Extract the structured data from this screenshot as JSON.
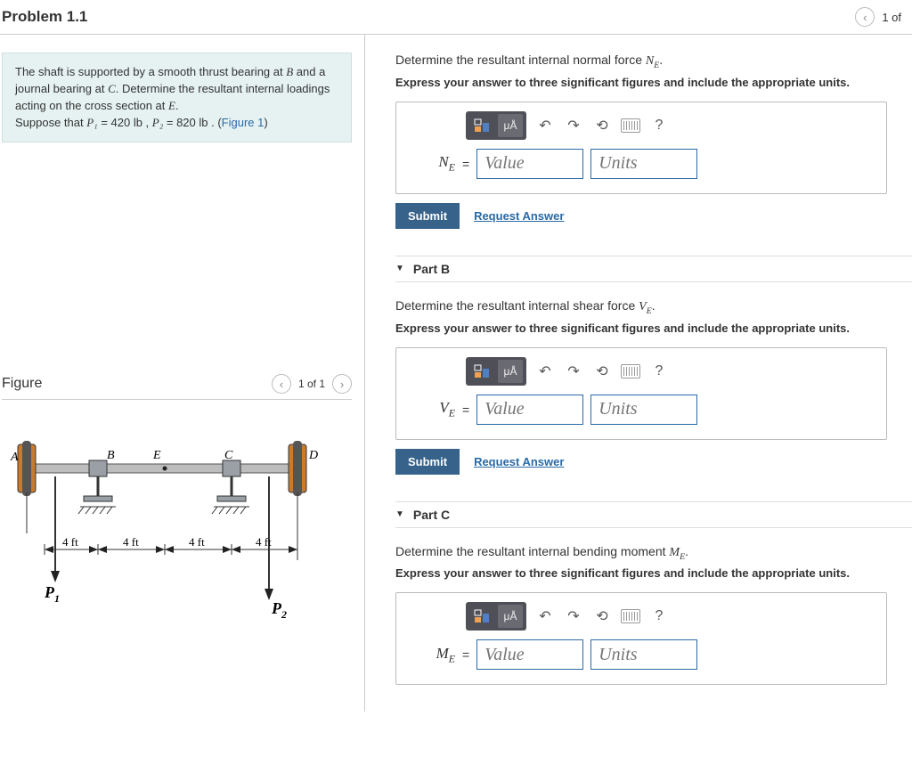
{
  "header": {
    "title": "Problem 1.1",
    "page_indicator": "1 of"
  },
  "problem_statement": {
    "line1_a": "The shaft is supported by a smooth thrust bearing at ",
    "B": "B",
    "line1_b": " and a journal bearing at ",
    "C": "C",
    "line1_c": ". Determine the resultant internal loadings acting on the cross section at ",
    "E": "E",
    "line1_d": ".",
    "line2_a": "Suppose that ",
    "P1": "P₁",
    "eq1": " = 420 lb , ",
    "P2": "P₂",
    "eq2": " = 820 lb . (",
    "figlink": "Figure 1",
    "close": ")"
  },
  "figure": {
    "title": "Figure",
    "pager": "1 of 1",
    "labels": {
      "A": "A",
      "B": "B",
      "E": "E",
      "C": "C",
      "D": "D",
      "P1": "P",
      "P1s": "1",
      "P2": "P",
      "P2s": "2",
      "seg": "4 ft"
    }
  },
  "parts": {
    "A": {
      "prompt_a": "Determine the resultant internal normal force ",
      "var": "N",
      "sub": "E",
      "prompt_b": ".",
      "inst": "Express your answer to three significant figures and include the appropriate units.",
      "label": "N",
      "labelsub": "E",
      "value_ph": "Value",
      "units_ph": "Units",
      "submit": "Submit",
      "request": "Request Answer"
    },
    "B": {
      "header": "Part B",
      "prompt_a": "Determine the resultant internal shear force ",
      "var": "V",
      "sub": "E",
      "prompt_b": ".",
      "inst": "Express your answer to three significant figures and include the appropriate units.",
      "label": "V",
      "labelsub": "E",
      "value_ph": "Value",
      "units_ph": "Units",
      "submit": "Submit",
      "request": "Request Answer"
    },
    "C": {
      "header": "Part C",
      "prompt_a": "Determine the resultant internal bending moment ",
      "var": "M",
      "sub": "E",
      "prompt_b": ".",
      "inst": "Express your answer to three significant figures and include the appropriate units.",
      "label": "M",
      "labelsub": "E",
      "value_ph": "Value",
      "units_ph": "Units",
      "submit": "Submit",
      "request": "Request Answer"
    }
  },
  "toolbar": {
    "ua": "μÅ",
    "help": "?"
  }
}
